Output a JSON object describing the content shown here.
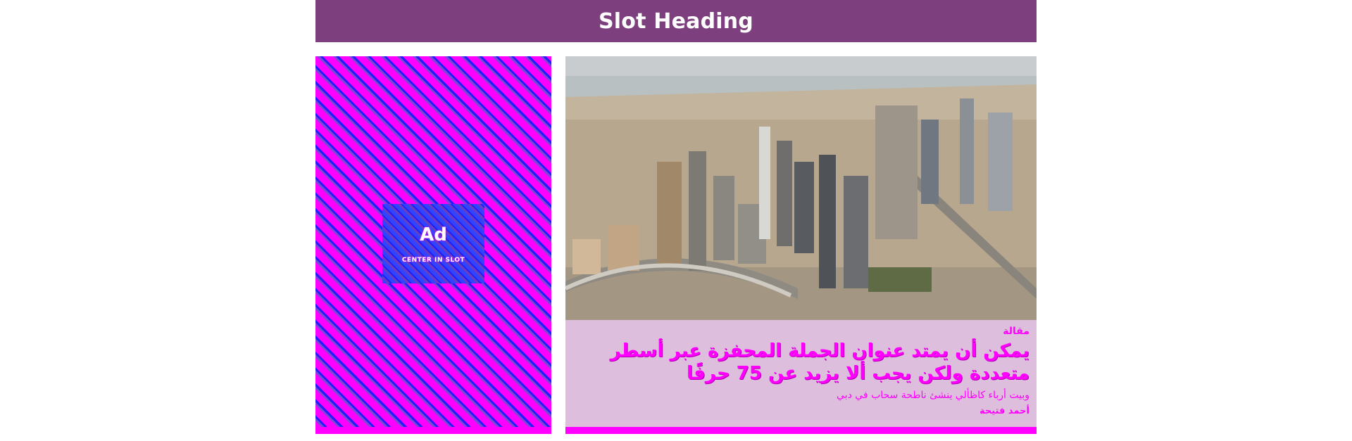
{
  "header": {
    "title": "Slot Heading"
  },
  "ad": {
    "label": "Ad",
    "sublabel": "CENTER IN SLOT"
  },
  "article": {
    "image_icon": "city-skyline-photo",
    "kicker": "مقالة",
    "title": "يمكن أن يمتد عنوان الجملة المحفزة عبر أسطر متعددة ولكن يجب ألا يزيد عن 75 حرفًا",
    "summary": "وبيت أرباء كاظألي ينشئ ناطحة سحاب في دبي",
    "author": "أحمد فتيحة"
  },
  "colors": {
    "header_bg": "#7d3f7e",
    "accent": "#ff00ff",
    "article_bg": "#ddbedd"
  }
}
